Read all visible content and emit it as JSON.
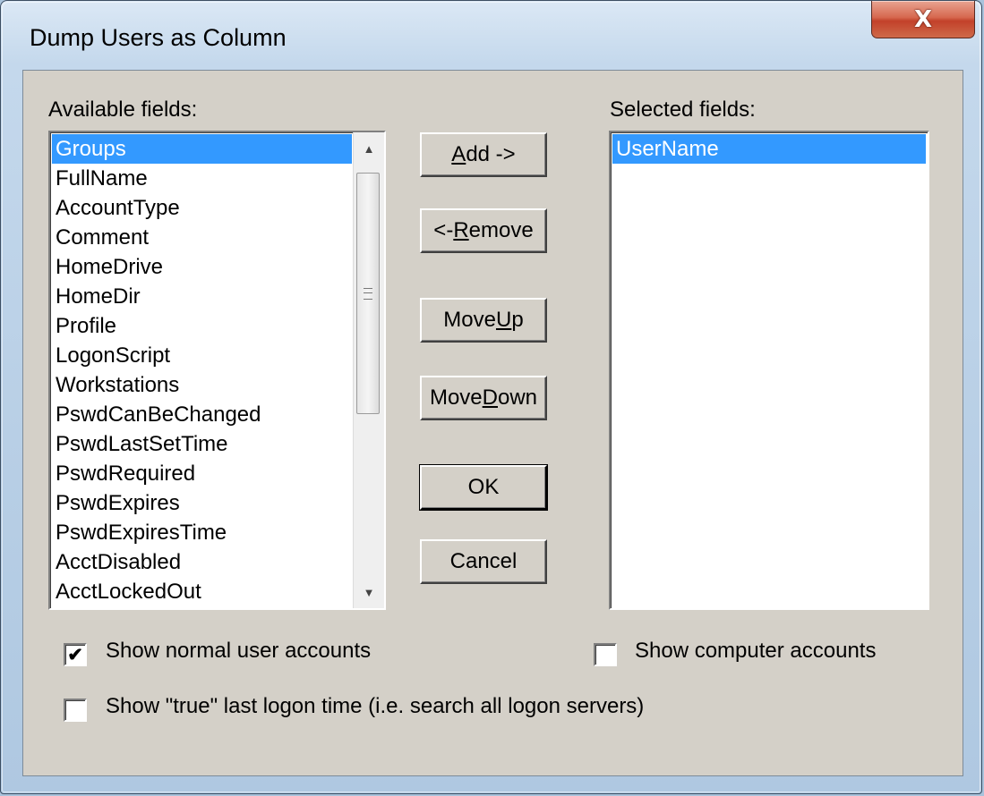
{
  "window": {
    "title": "Dump Users as Column",
    "close_label": "X"
  },
  "available": {
    "label": "Available fields:",
    "items": [
      {
        "label": "Groups",
        "selected": true
      },
      {
        "label": "FullName"
      },
      {
        "label": "AccountType"
      },
      {
        "label": "Comment"
      },
      {
        "label": "HomeDrive"
      },
      {
        "label": "HomeDir"
      },
      {
        "label": "Profile"
      },
      {
        "label": "LogonScript"
      },
      {
        "label": "Workstations"
      },
      {
        "label": "PswdCanBeChanged"
      },
      {
        "label": "PswdLastSetTime"
      },
      {
        "label": "PswdRequired"
      },
      {
        "label": "PswdExpires"
      },
      {
        "label": "PswdExpiresTime"
      },
      {
        "label": "AcctDisabled"
      },
      {
        "label": "AcctLockedOut"
      }
    ]
  },
  "selected": {
    "label": "Selected fields:",
    "items": [
      {
        "label": "UserName",
        "selected": true
      }
    ]
  },
  "buttons": {
    "add": {
      "before": "",
      "key": "A",
      "after": "dd ->"
    },
    "remove": {
      "before": "<- ",
      "key": "R",
      "after": "emove"
    },
    "move_up": {
      "before": "Move ",
      "key": "U",
      "after": "p"
    },
    "move_down": {
      "before": "Move ",
      "key": "D",
      "after": "own"
    },
    "ok": "OK",
    "cancel": "Cancel"
  },
  "options": {
    "show_normal": {
      "label": "Show normal user accounts",
      "checked": true
    },
    "show_computer": {
      "label": "Show computer accounts",
      "checked": false
    },
    "show_true_logon": {
      "label": "Show \"true\" last logon time (i.e. search all logon servers)",
      "checked": false
    }
  }
}
